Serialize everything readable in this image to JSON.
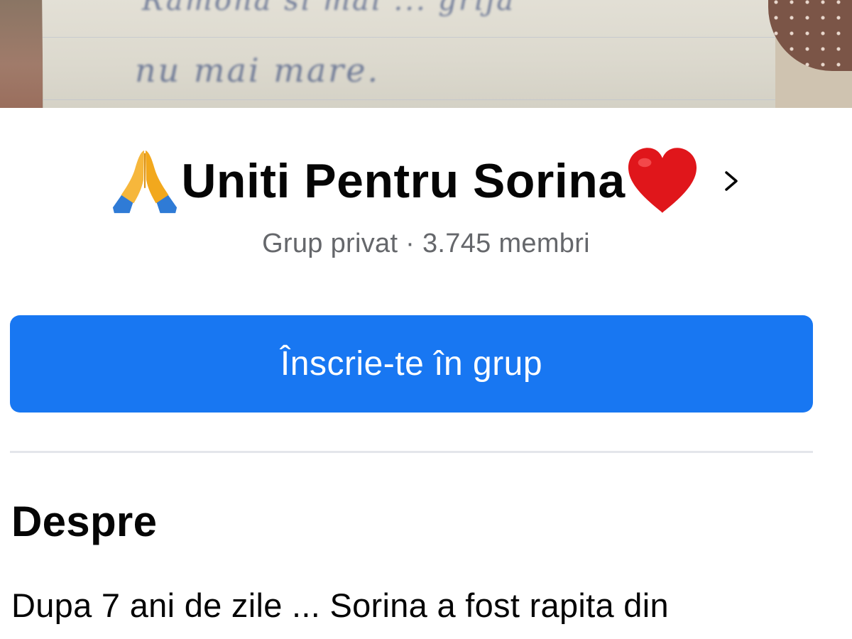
{
  "cover": {
    "handwriting_line_1": "Ramona si mai ... grija",
    "handwriting_line_2": "nu mai mare."
  },
  "group": {
    "name": "Uniti Pentru Sorina",
    "meta": "Grup privat · 3.745 membri",
    "title_icon_left": "folded-hands-emoji",
    "title_icon_right": "red-heart-emoji",
    "chevron_icon": "chevron-right-icon"
  },
  "actions": {
    "join_label": "Înscrie-te în grup",
    "join_color": "#1877f2"
  },
  "about": {
    "heading": "Despre",
    "text": "Dupa 7 ani de zile ... Sorina a fost rapita din"
  }
}
